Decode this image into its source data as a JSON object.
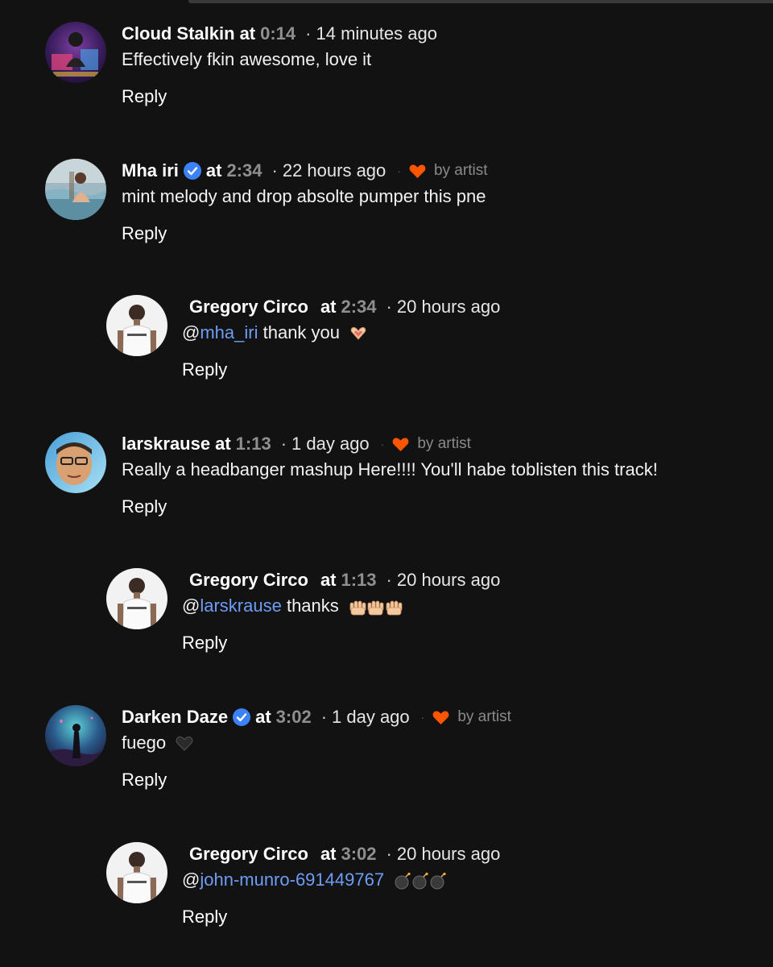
{
  "comments": [
    {
      "username": "Cloud Stalkin",
      "at_label": "at",
      "timestamp": "0:14",
      "ago": "14 minutes ago",
      "text": "Effectively fkin awesome, love it",
      "reply_label": "Reply"
    },
    {
      "username": "Mha iri",
      "verified": true,
      "at_label": "at",
      "timestamp": "2:34",
      "ago": "22 hours ago",
      "liked_by_artist": "by artist",
      "text": "mint melody and drop absolte pumper this pne",
      "reply_label": "Reply"
    },
    {
      "username": "Gregory Circo",
      "at_label": "at",
      "timestamp": "2:34",
      "ago": "20 hours ago",
      "mention": "mha_iri",
      "text": "thank you",
      "emoji": "heart-hands-emoji",
      "reply_label": "Reply"
    },
    {
      "username": "larskrause",
      "at_label": "at",
      "timestamp": "1:13",
      "ago": "1 day ago",
      "liked_by_artist": "by artist",
      "text": "Really a headbanger mashup Here!!!! You'll habe toblisten this track!",
      "reply_label": "Reply"
    },
    {
      "username": "Gregory Circo",
      "at_label": "at",
      "timestamp": "1:13",
      "ago": "20 hours ago",
      "mention": "larskrause",
      "text": "thanks",
      "emoji": "raising-hands-emoji",
      "reply_label": "Reply"
    },
    {
      "username": "Darken Daze",
      "verified": true,
      "at_label": "at",
      "timestamp": "3:02",
      "ago": "1 day ago",
      "liked_by_artist": "by artist",
      "text": "fuego",
      "emoji": "black-heart-emoji",
      "reply_label": "Reply"
    },
    {
      "username": "Gregory Circo",
      "at_label": "at",
      "timestamp": "3:02",
      "ago": "20 hours ago",
      "mention": "john-munro-691449767",
      "emoji": "bomb-emoji",
      "reply_label": "Reply"
    }
  ],
  "colors": {
    "background": "#121212",
    "mention": "#6e9df5",
    "heart": "#ff5500",
    "verified": "#3b82f6",
    "timestamp": "#8f8f8f"
  }
}
